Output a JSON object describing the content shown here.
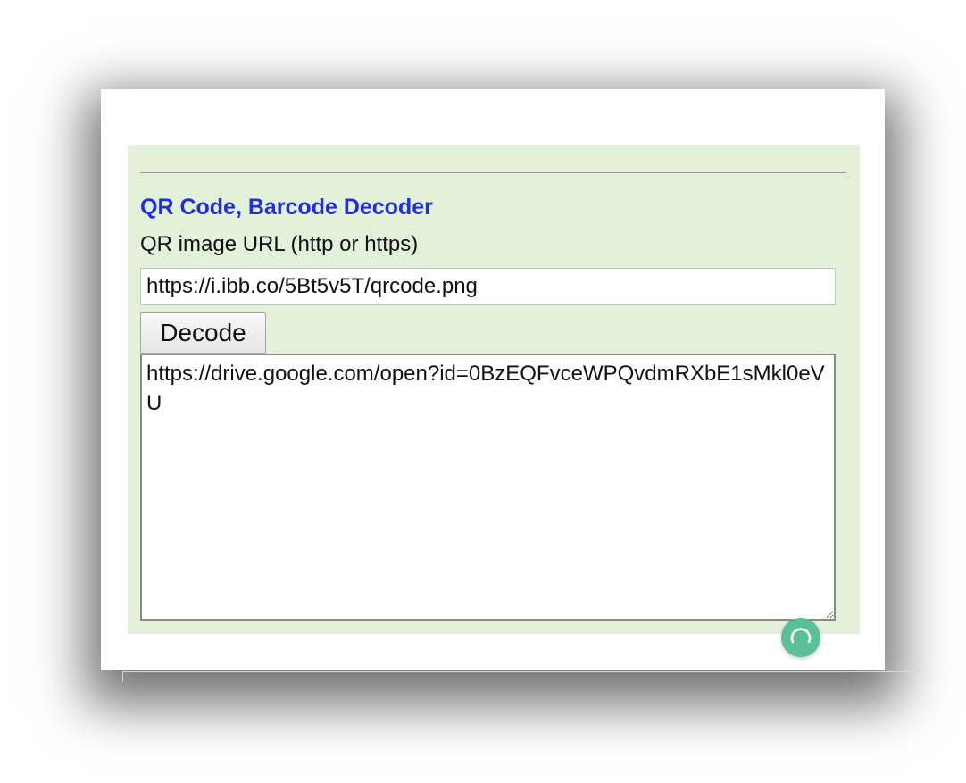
{
  "decoder": {
    "title": "QR Code, Barcode Decoder",
    "url_label": "QR image URL (http or https)",
    "url_value": "https://i.ibb.co/5Bt5v5T/qrcode.png",
    "decode_label": "Decode",
    "result_text": "https://drive.google.com/open?id=0BzEQFvceWPQvdmRXbE1sMkl0eVU"
  },
  "floating_button": {
    "icon": "refresh-icon",
    "color": "#5bbf97"
  },
  "colors": {
    "panel_background": "#e3f0da",
    "title": "#1f2ee0"
  }
}
